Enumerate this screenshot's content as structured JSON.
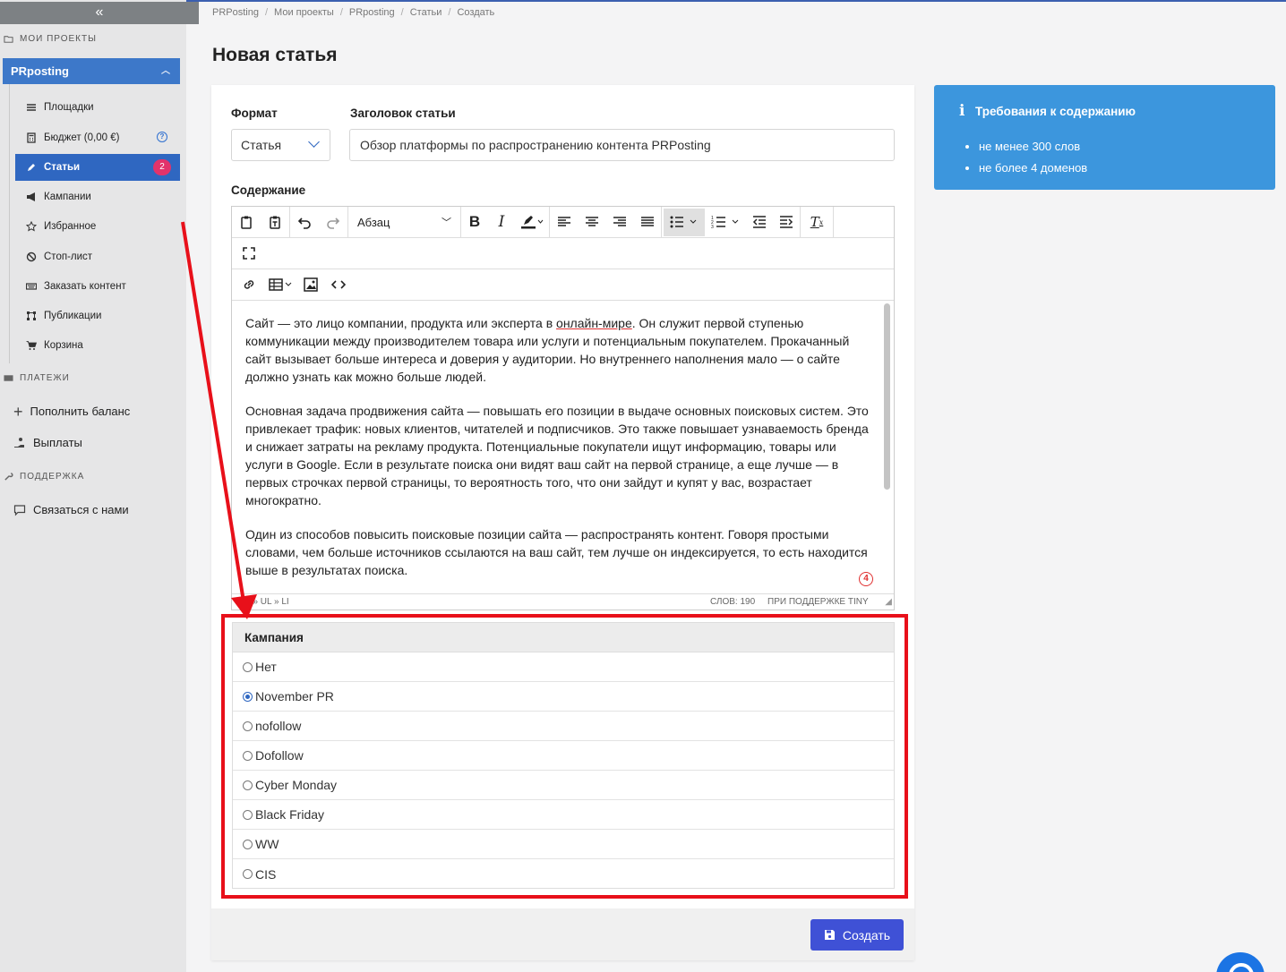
{
  "sidebar": {
    "collapse_label": "«",
    "section_projects": "МОИ ПРОЕКТЫ",
    "project_name": "PRposting",
    "items": [
      {
        "label": "Площадки",
        "icon": "list-icon"
      },
      {
        "label": "Бюджет (0,00 €)",
        "icon": "calculator-icon"
      },
      {
        "label": "Статьи",
        "icon": "pencil-icon",
        "badge": "2"
      },
      {
        "label": "Кампании",
        "icon": "megaphone-icon"
      },
      {
        "label": "Избранное",
        "icon": "star-icon"
      },
      {
        "label": "Стоп-лист",
        "icon": "ban-icon"
      },
      {
        "label": "Заказать контент",
        "icon": "keyboard-icon"
      },
      {
        "label": "Публикации",
        "icon": "sitemap-icon"
      },
      {
        "label": "Корзина",
        "icon": "cart-icon"
      }
    ],
    "section_payments": "ПЛАТЕЖИ",
    "payments": [
      {
        "label": "Пополнить баланс",
        "icon": "plus-icon"
      },
      {
        "label": "Выплаты",
        "icon": "hand-coin-icon"
      }
    ],
    "section_support": "ПОДДЕРЖКА",
    "support": [
      {
        "label": "Связаться с нами",
        "icon": "chat-icon"
      }
    ]
  },
  "breadcrumbs": [
    "PRPosting",
    "Мои проекты",
    "PRposting",
    "Статьи",
    "Создать"
  ],
  "page_title": "Новая статья",
  "form": {
    "format_label": "Формат",
    "format_value": "Статья",
    "title_label": "Заголовок статьи",
    "title_value": "Обзор платформы по распространению контента PRPosting",
    "content_label": "Содержание",
    "block_format": "Абзац",
    "paragraphs": {
      "p1_a": "Сайт — это лицо компании, продукта или эксперта в ",
      "p1_link": "онлайн-мире",
      "p1_b": ". Он служит первой ступенью коммуникации между производителем товара или услуги и потенциальным покупателем. Прокачанный сайт вызывает больше интереса и доверия у аудитории. Но внутреннего наполнения мало — о сайте должно узнать как можно больше людей.",
      "p2": "Основная задача продвижения сайта — повышать его позиции в выдаче основных поисковых систем. Это привлекает трафик: новых клиентов, читателей и подписчиков. Это также повышает узнаваемость бренда и снижает затраты на рекламу продукта. Потенциальные покупатели ищут информацию, товары или услуги в Google. Если в результате поиска они видят ваш сайт на первой странице, а еще лучше — в первых строчках первой страницы, то вероятность того, что они зайдут и купят у вас, возрастает многократно.",
      "p3": "Один из способов повысить поисковые позиции сайта — распространять контент. Говоря простыми словами, чем больше источников ссылаются на ваш сайт, тем лучше он индексируется, то есть находится выше в результатах поиска."
    },
    "path": "V » UL » LI",
    "word_count": "СЛОВ: 190",
    "powered": "ПРИ ПОДДЕРЖКЕ TINY",
    "grammar_count": "4"
  },
  "campaign": {
    "header": "Кампания",
    "options": [
      "Нет",
      "November PR",
      "nofollow",
      "Dofollow",
      "Cyber Monday",
      "Black Friday",
      "WW",
      "CIS"
    ],
    "selected": "November PR"
  },
  "info": {
    "title": "Требования к содержанию",
    "items": [
      "не менее 300 слов",
      "не более 4 доменов"
    ],
    "color": "#3c96dd"
  },
  "create_button": "Создать",
  "colors": {
    "accent": "#2f67c1",
    "badge": "#e2336b",
    "annotation": "#e8101a",
    "button": "#3f51d6"
  }
}
